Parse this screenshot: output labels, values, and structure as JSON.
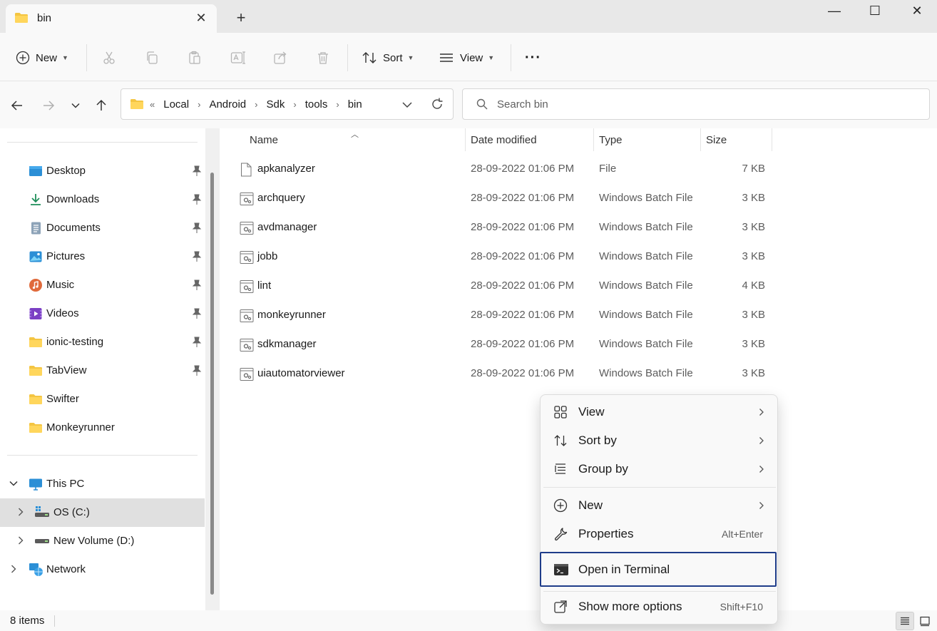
{
  "window": {
    "tab_title": "bin",
    "controls": {
      "minimize": "—",
      "maximize": "☐",
      "close": "✕"
    }
  },
  "toolbar": {
    "new_label": "New",
    "sort_label": "Sort",
    "view_label": "View",
    "more_label": "···"
  },
  "address": {
    "overflow": "«",
    "crumbs": [
      "Local",
      "Android",
      "Sdk",
      "tools",
      "bin"
    ],
    "search_placeholder": "Search bin"
  },
  "sidebar": {
    "quick_access": [
      {
        "label": "Desktop",
        "icon": "desktop-icon"
      },
      {
        "label": "Downloads",
        "icon": "downloads-icon"
      },
      {
        "label": "Documents",
        "icon": "documents-icon"
      },
      {
        "label": "Pictures",
        "icon": "pictures-icon"
      },
      {
        "label": "Music",
        "icon": "music-icon"
      },
      {
        "label": "Videos",
        "icon": "videos-icon"
      },
      {
        "label": "ionic-testing",
        "icon": "folder-icon"
      },
      {
        "label": "TabView",
        "icon": "folder-icon"
      },
      {
        "label": "Swifter",
        "icon": "folder-icon"
      },
      {
        "label": "Monkeyrunner",
        "icon": "folder-icon"
      }
    ],
    "this_pc": "This PC",
    "drive_c": "OS (C:)",
    "drive_d": "New Volume (D:)",
    "network": "Network"
  },
  "columns": {
    "name": "Name",
    "date": "Date modified",
    "type": "Type",
    "size": "Size"
  },
  "files": [
    {
      "name": "apkanalyzer",
      "date": "28-09-2022 01:06 PM",
      "type": "File",
      "size": "7 KB"
    },
    {
      "name": "archquery",
      "date": "28-09-2022 01:06 PM",
      "type": "Windows Batch File",
      "size": "3 KB"
    },
    {
      "name": "avdmanager",
      "date": "28-09-2022 01:06 PM",
      "type": "Windows Batch File",
      "size": "3 KB"
    },
    {
      "name": "jobb",
      "date": "28-09-2022 01:06 PM",
      "type": "Windows Batch File",
      "size": "3 KB"
    },
    {
      "name": "lint",
      "date": "28-09-2022 01:06 PM",
      "type": "Windows Batch File",
      "size": "4 KB"
    },
    {
      "name": "monkeyrunner",
      "date": "28-09-2022 01:06 PM",
      "type": "Windows Batch File",
      "size": "3 KB"
    },
    {
      "name": "sdkmanager",
      "date": "28-09-2022 01:06 PM",
      "type": "Windows Batch File",
      "size": "3 KB"
    },
    {
      "name": "uiautomatorviewer",
      "date": "28-09-2022 01:06 PM",
      "type": "Windows Batch File",
      "size": "3 KB"
    }
  ],
  "status": {
    "count": "8 items"
  },
  "context_menu": {
    "view": "View",
    "sort_by": "Sort by",
    "group_by": "Group by",
    "new": "New",
    "properties": "Properties",
    "properties_shortcut": "Alt+Enter",
    "open_terminal": "Open in Terminal",
    "show_more": "Show more options",
    "show_more_shortcut": "Shift+F10"
  },
  "colors": {
    "accent": "#1f3d8a",
    "folder": "#f4c542",
    "selected_bg": "#e0e0e0"
  }
}
